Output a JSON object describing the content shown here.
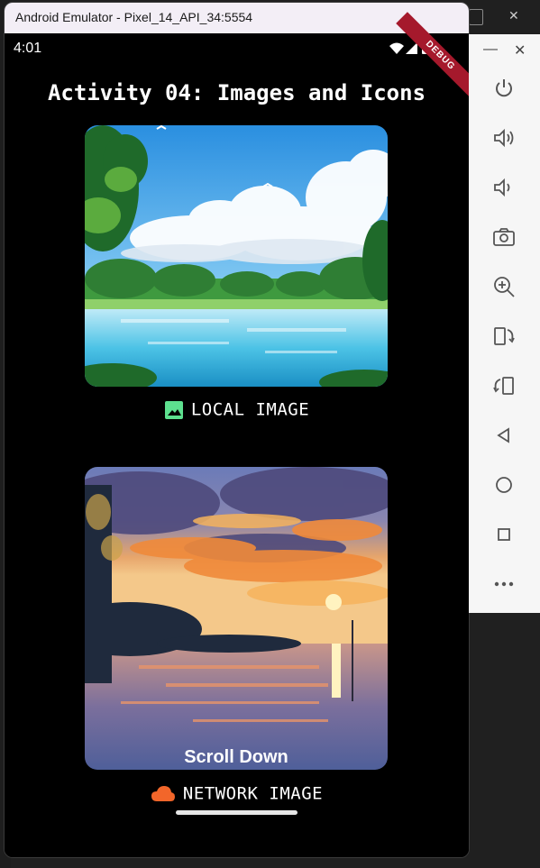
{
  "window": {
    "title": "Android Emulator - Pixel_14_API_34:5554",
    "minimize_label": "—",
    "close_label": "✕"
  },
  "statusbar": {
    "time": "4:01",
    "debug_label": "DEBUG"
  },
  "app": {
    "title": "Activity 04: Images and Icons",
    "local_caption": "LOCAL IMAGE",
    "network_caption": "NETWORK IMAGE",
    "scroll_hint": "Scroll Down",
    "local_icon": "image-icon",
    "network_icon": "cloud-icon",
    "accent_local": "#5de08f",
    "accent_network": "#f2662a"
  },
  "side_panel": {
    "buttons": [
      "power-icon",
      "volume-up-icon",
      "volume-down-icon",
      "camera-icon",
      "zoom-in-icon",
      "rotate-left-icon",
      "rotate-right-icon",
      "back-icon",
      "home-icon",
      "overview-icon",
      "more-icon"
    ]
  },
  "background": {
    "behind_close": "✕"
  }
}
